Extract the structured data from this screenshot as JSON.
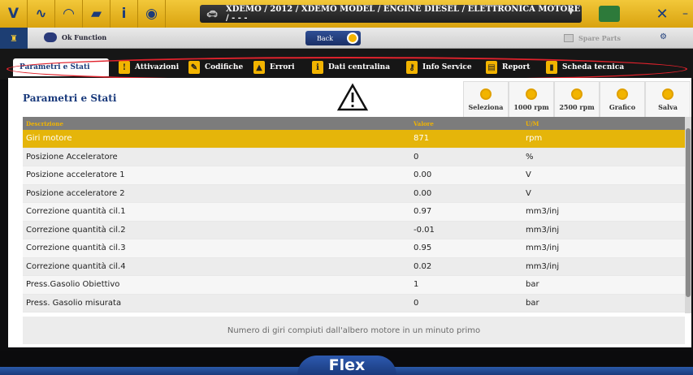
{
  "toolbar": {
    "vehicle_path": "XDEMO / 2012 / XDEMO MODEL / ENGINE DIESEL / ELETTRONICA MOTORE / - - -"
  },
  "subbar": {
    "ok_function": "Ok Function",
    "back": "Back",
    "spare_parts": "Spare Parts"
  },
  "tabs": [
    {
      "label": "Parametri e Stati",
      "active": true
    },
    {
      "label": "Attivazioni"
    },
    {
      "label": "Codifiche"
    },
    {
      "label": "Errori"
    },
    {
      "label": "Dati centralina"
    },
    {
      "label": "Info Service"
    },
    {
      "label": "Report"
    },
    {
      "label": "Scheda tecnica"
    }
  ],
  "panel": {
    "title": "Parametri e Stati",
    "tools": [
      {
        "label": "Seleziona"
      },
      {
        "label": "1000 rpm"
      },
      {
        "label": "2500 rpm"
      },
      {
        "label": "Grafico"
      },
      {
        "label": "Salva"
      }
    ],
    "columns": {
      "desc": "Descrizione",
      "value": "Valore",
      "unit": "U/M"
    },
    "rows": [
      {
        "desc": "Giri motore",
        "value": "871",
        "unit": "rpm",
        "selected": true
      },
      {
        "desc": "Posizione Acceleratore",
        "value": "0",
        "unit": "%"
      },
      {
        "desc": "Posizione acceleratore 1",
        "value": "0.00",
        "unit": "V"
      },
      {
        "desc": "Posizione acceleratore 2",
        "value": "0.00",
        "unit": "V"
      },
      {
        "desc": "Correzione quantità cil.1",
        "value": "0.97",
        "unit": "mm3/inj"
      },
      {
        "desc": "Correzione quantità cil.2",
        "value": "-0.01",
        "unit": "mm3/inj"
      },
      {
        "desc": "Correzione quantità cil.3",
        "value": "0.95",
        "unit": "mm3/inj"
      },
      {
        "desc": "Correzione quantità cil.4",
        "value": "0.02",
        "unit": "mm3/inj"
      },
      {
        "desc": "Press.Gasolio Obiettivo",
        "value": "1",
        "unit": "bar"
      },
      {
        "desc": "Press. Gasolio misurata",
        "value": "0",
        "unit": "bar"
      }
    ],
    "description": "Numero di giri compiuti dall'albero motore in un minuto primo"
  },
  "footer": {
    "brand": "Flex"
  }
}
